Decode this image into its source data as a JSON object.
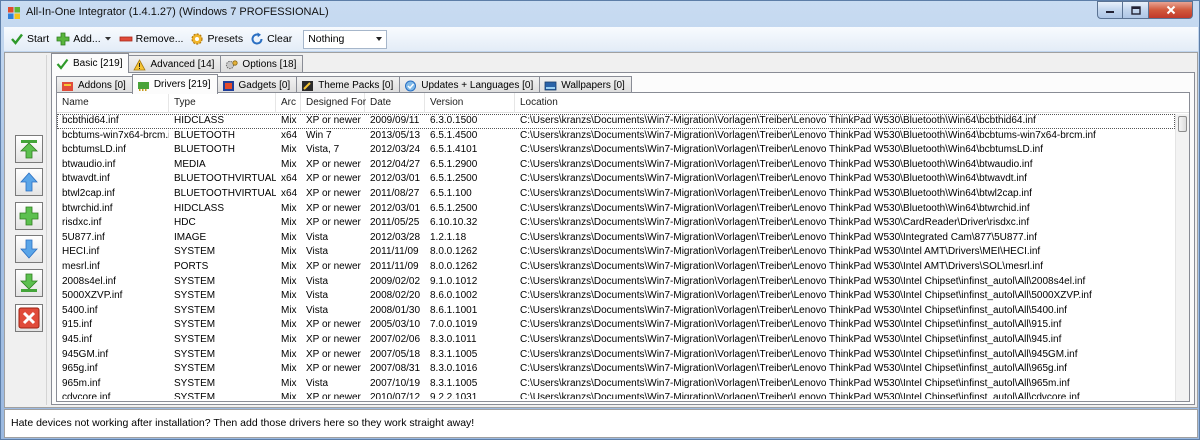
{
  "window": {
    "title": "All-In-One Integrator (1.4.1.27) (Windows 7 PROFESSIONAL)"
  },
  "toolbar": {
    "start": "Start",
    "add": "Add...",
    "remove": "Remove...",
    "presets": "Presets",
    "clear": "Clear",
    "filter_value": "Nothing"
  },
  "tabs_outer": [
    {
      "label": "Basic [219]",
      "icon": "checkmark-icon",
      "active": true
    },
    {
      "label": "Advanced [14]",
      "icon": "warning-icon",
      "active": false
    },
    {
      "label": "Options [18]",
      "icon": "gears-icon",
      "active": false
    }
  ],
  "tabs_inner": [
    {
      "label": "Addons [0]",
      "icon": "addons-icon",
      "active": false
    },
    {
      "label": "Drivers [219]",
      "icon": "driver-icon",
      "active": true
    },
    {
      "label": "Gadgets [0]",
      "icon": "gadget-icon",
      "active": false
    },
    {
      "label": "Theme Packs [0]",
      "icon": "theme-icon",
      "active": false
    },
    {
      "label": "Updates + Languages [0]",
      "icon": "updates-icon",
      "active": false
    },
    {
      "label": "Wallpapers [0]",
      "icon": "wallpaper-icon",
      "active": false
    }
  ],
  "columns": {
    "name": "Name",
    "type": "Type",
    "arc": "Arc",
    "designed_for": "Designed For",
    "date": "Date",
    "version": "Version",
    "location": "Location"
  },
  "rows": [
    [
      "bcbthid64.inf",
      "HIDCLASS",
      "Mix",
      "XP or newer",
      "2009/09/11",
      "6.3.0.1500",
      "C:\\Users\\kranzs\\Documents\\Win7-Migration\\Vorlagen\\Treiber\\Lenovo ThinkPad W530\\Bluetooth\\Win64\\bcbthid64.inf"
    ],
    [
      "bcbtums-win7x64-brcm.inf",
      "BLUETOOTH",
      "x64",
      "Win 7",
      "2013/05/13",
      "6.5.1.4500",
      "C:\\Users\\kranzs\\Documents\\Win7-Migration\\Vorlagen\\Treiber\\Lenovo ThinkPad W530\\Bluetooth\\Win64\\bcbtums-win7x64-brcm.inf"
    ],
    [
      "bcbtumsLD.inf",
      "BLUETOOTH",
      "Mix",
      "Vista, 7",
      "2012/03/24",
      "6.5.1.4101",
      "C:\\Users\\kranzs\\Documents\\Win7-Migration\\Vorlagen\\Treiber\\Lenovo ThinkPad W530\\Bluetooth\\Win64\\bcbtumsLD.inf"
    ],
    [
      "btwaudio.inf",
      "MEDIA",
      "Mix",
      "XP or newer",
      "2012/04/27",
      "6.5.1.2900",
      "C:\\Users\\kranzs\\Documents\\Win7-Migration\\Vorlagen\\Treiber\\Lenovo ThinkPad W530\\Bluetooth\\Win64\\btwaudio.inf"
    ],
    [
      "btwavdt.inf",
      "BLUETOOTHVIRTUAL",
      "x64",
      "XP or newer",
      "2012/03/01",
      "6.5.1.2500",
      "C:\\Users\\kranzs\\Documents\\Win7-Migration\\Vorlagen\\Treiber\\Lenovo ThinkPad W530\\Bluetooth\\Win64\\btwavdt.inf"
    ],
    [
      "btwl2cap.inf",
      "BLUETOOTHVIRTUAL",
      "x64",
      "XP or newer",
      "2011/08/27",
      "6.5.1.100",
      "C:\\Users\\kranzs\\Documents\\Win7-Migration\\Vorlagen\\Treiber\\Lenovo ThinkPad W530\\Bluetooth\\Win64\\btwl2cap.inf"
    ],
    [
      "btwrchid.inf",
      "HIDCLASS",
      "Mix",
      "XP or newer",
      "2012/03/01",
      "6.5.1.2500",
      "C:\\Users\\kranzs\\Documents\\Win7-Migration\\Vorlagen\\Treiber\\Lenovo ThinkPad W530\\Bluetooth\\Win64\\btwrchid.inf"
    ],
    [
      "risdxc.inf",
      "HDC",
      "Mix",
      "XP or newer",
      "2011/05/25",
      "6.10.10.32",
      "C:\\Users\\kranzs\\Documents\\Win7-Migration\\Vorlagen\\Treiber\\Lenovo ThinkPad W530\\CardReader\\Driver\\risdxc.inf"
    ],
    [
      "5U877.inf",
      "IMAGE",
      "Mix",
      "Vista",
      "2012/03/28",
      "1.2.1.18",
      "C:\\Users\\kranzs\\Documents\\Win7-Migration\\Vorlagen\\Treiber\\Lenovo ThinkPad W530\\Integrated Cam\\877\\5U877.inf"
    ],
    [
      "HECI.inf",
      "SYSTEM",
      "Mix",
      "Vista",
      "2011/11/09",
      "8.0.0.1262",
      "C:\\Users\\kranzs\\Documents\\Win7-Migration\\Vorlagen\\Treiber\\Lenovo ThinkPad W530\\Intel AMT\\Drivers\\MEI\\HECI.inf"
    ],
    [
      "mesrl.inf",
      "PORTS",
      "Mix",
      "XP or newer",
      "2011/11/09",
      "8.0.0.1262",
      "C:\\Users\\kranzs\\Documents\\Win7-Migration\\Vorlagen\\Treiber\\Lenovo ThinkPad W530\\Intel AMT\\Drivers\\SOL\\mesrl.inf"
    ],
    [
      "2008s4el.inf",
      "SYSTEM",
      "Mix",
      "Vista",
      "2009/02/02",
      "9.1.0.1012",
      "C:\\Users\\kranzs\\Documents\\Win7-Migration\\Vorlagen\\Treiber\\Lenovo ThinkPad W530\\Intel Chipset\\infinst_autol\\All\\2008s4el.inf"
    ],
    [
      "5000XZVP.inf",
      "SYSTEM",
      "Mix",
      "Vista",
      "2008/02/20",
      "8.6.0.1002",
      "C:\\Users\\kranzs\\Documents\\Win7-Migration\\Vorlagen\\Treiber\\Lenovo ThinkPad W530\\Intel Chipset\\infinst_autol\\All\\5000XZVP.inf"
    ],
    [
      "5400.inf",
      "SYSTEM",
      "Mix",
      "Vista",
      "2008/01/30",
      "8.6.1.1001",
      "C:\\Users\\kranzs\\Documents\\Win7-Migration\\Vorlagen\\Treiber\\Lenovo ThinkPad W530\\Intel Chipset\\infinst_autol\\All\\5400.inf"
    ],
    [
      "915.inf",
      "SYSTEM",
      "Mix",
      "XP or newer",
      "2005/03/10",
      "7.0.0.1019",
      "C:\\Users\\kranzs\\Documents\\Win7-Migration\\Vorlagen\\Treiber\\Lenovo ThinkPad W530\\Intel Chipset\\infinst_autol\\All\\915.inf"
    ],
    [
      "945.inf",
      "SYSTEM",
      "Mix",
      "XP or newer",
      "2007/02/06",
      "8.3.0.1011",
      "C:\\Users\\kranzs\\Documents\\Win7-Migration\\Vorlagen\\Treiber\\Lenovo ThinkPad W530\\Intel Chipset\\infinst_autol\\All\\945.inf"
    ],
    [
      "945GM.inf",
      "SYSTEM",
      "Mix",
      "XP or newer",
      "2007/05/18",
      "8.3.1.1005",
      "C:\\Users\\kranzs\\Documents\\Win7-Migration\\Vorlagen\\Treiber\\Lenovo ThinkPad W530\\Intel Chipset\\infinst_autol\\All\\945GM.inf"
    ],
    [
      "965g.inf",
      "SYSTEM",
      "Mix",
      "XP or newer",
      "2007/08/31",
      "8.3.0.1016",
      "C:\\Users\\kranzs\\Documents\\Win7-Migration\\Vorlagen\\Treiber\\Lenovo ThinkPad W530\\Intel Chipset\\infinst_autol\\All\\965g.inf"
    ],
    [
      "965m.inf",
      "SYSTEM",
      "Mix",
      "Vista",
      "2007/10/19",
      "8.3.1.1005",
      "C:\\Users\\kranzs\\Documents\\Win7-Migration\\Vorlagen\\Treiber\\Lenovo ThinkPad W530\\Intel Chipset\\infinst_autol\\All\\965m.inf"
    ],
    [
      "cdvcore.inf",
      "SYSTEM",
      "Mix",
      "XP or newer",
      "2010/07/12",
      "9.2.2.1031",
      "C:\\Users\\kranzs\\Documents\\Win7-Migration\\Vorlagen\\Treiber\\Lenovo ThinkPad W530\\Intel Chipset\\infinst_autol\\All\\cdvcore.inf"
    ]
  ],
  "status": "Hate devices not working after installation? Then add those drivers here so they work straight away!",
  "colors": {
    "accent": "#a9c4e6",
    "selection_outline": "#555555"
  }
}
